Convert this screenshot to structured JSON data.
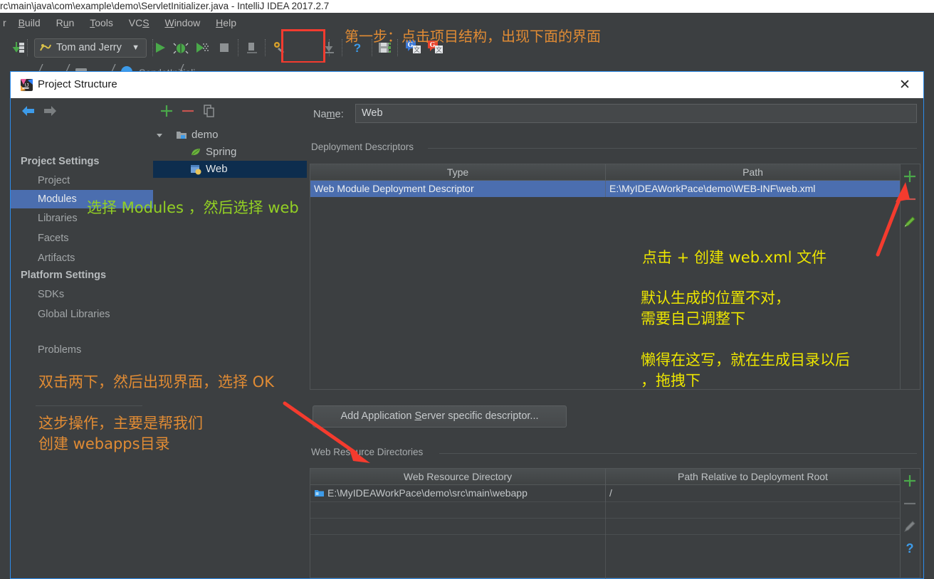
{
  "ide": {
    "window_title": "rc\\main\\java\\com\\example\\demo\\ServletInitializer.java - IntelliJ IDEA 2017.2.7",
    "menu": [
      {
        "label": "r",
        "mnemonic": ""
      },
      {
        "label": "Build",
        "mnemonic": "B"
      },
      {
        "label": "Run",
        "mnemonic": "u"
      },
      {
        "label": "Tools",
        "mnemonic": "T"
      },
      {
        "label": "VCS",
        "mnemonic": "S"
      },
      {
        "label": "Window",
        "mnemonic": "W"
      },
      {
        "label": "Help",
        "mnemonic": "H"
      }
    ],
    "run_configuration": "Tom and Jerry",
    "toolbar_icons": [
      "update-project-icon",
      "run-configuration-selector",
      "run-icon",
      "debug-icon",
      "run-with-coverage-icon",
      "stop-icon",
      "build-icon",
      "settings-icon",
      "project-structure-icon",
      "attach-debugger-icon",
      "help-icon",
      "save-all-icon",
      "google-translate-icon-blue",
      "google-translate-icon-red"
    ]
  },
  "annotations": {
    "step1": "第一步：点击项目结构，出现下面的界面",
    "modules_hint": "选择 Modules ，然后选择 web",
    "plus_hint": "点击 + 创建 web.xml 文件",
    "position_hint_line1": "默认生成的位置不对，",
    "position_hint_line2": "需要自己调整下",
    "lazy_hint_line1": "懒得在这写，就在生成目录以后",
    "lazy_hint_line2": "，拖拽下",
    "dblclick_hint": "双击两下，然后出现界面，选择 OK",
    "webapps_hint_line1": "这步操作，主要是帮我们",
    "webapps_hint_line2": "创建 webapps目录",
    "colors": {
      "orange": "#e08b34",
      "green": "#93d024",
      "yellow": "#ece500",
      "arrow_red": "#f43b2e",
      "highlight_red": "#f23b2f"
    }
  },
  "dialog": {
    "title": "Project Structure",
    "close_label": "✕",
    "nav": {
      "back_icon": "arrow-left-icon",
      "forward_icon": "arrow-right-icon",
      "groups": [
        {
          "label": "Project Settings",
          "items": [
            {
              "label": "Project",
              "selected": false
            },
            {
              "label": "Modules",
              "selected": true
            },
            {
              "label": "Libraries",
              "selected": false
            },
            {
              "label": "Facets",
              "selected": false
            },
            {
              "label": "Artifacts",
              "selected": false
            }
          ]
        },
        {
          "label": "Platform Settings",
          "items": [
            {
              "label": "SDKs",
              "selected": false
            },
            {
              "label": "Global Libraries",
              "selected": false
            }
          ]
        }
      ],
      "problems": "Problems"
    },
    "tree": {
      "toolbar": [
        "add-icon",
        "remove-icon",
        "copy-icon"
      ],
      "nodes": [
        {
          "label": "demo",
          "icon": "module-folder-icon",
          "depth": 0,
          "expanded": true,
          "selected": false
        },
        {
          "label": "Spring",
          "icon": "spring-leaf-icon",
          "depth": 1,
          "expanded": false,
          "selected": false
        },
        {
          "label": "Web",
          "icon": "web-facet-icon",
          "depth": 1,
          "expanded": false,
          "selected": true
        }
      ]
    },
    "content": {
      "name_label": "Name:",
      "name_mnemonic": "m",
      "name_value": "Web",
      "deployment_descriptors": {
        "section_title": "Deployment Descriptors",
        "columns": [
          "Type",
          "Path"
        ],
        "rows": [
          {
            "type": "Web Module Deployment Descriptor",
            "path": "E:\\MyIDEAWorkPace\\demo\\WEB-INF\\web.xml",
            "selected": true
          }
        ],
        "side_buttons": [
          "add-icon",
          "remove-icon",
          "edit-pencil-icon"
        ]
      },
      "add_descriptor_button": {
        "label": "Add Application Server specific descriptor...",
        "mnemonic": "S"
      },
      "web_resource_directories": {
        "section_title": "Web Resource Directories",
        "columns": [
          "Web Resource Directory",
          "Path Relative to Deployment Root"
        ],
        "rows": [
          {
            "directory": "E:\\MyIDEAWorkPace\\demo\\src\\main\\webapp",
            "relative_path": "/",
            "icon": "folder-icon",
            "selected": false
          }
        ],
        "side_buttons": [
          "add-icon",
          "remove-icon",
          "edit-pencil-icon",
          "help-icon"
        ]
      }
    }
  }
}
